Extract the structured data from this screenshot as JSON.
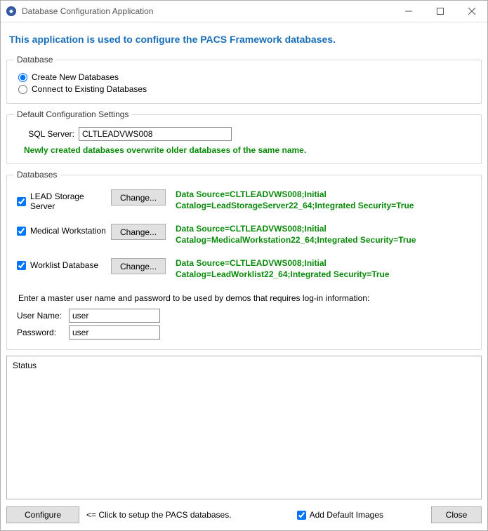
{
  "window": {
    "title": "Database Configuration Application"
  },
  "headline": "This application is used to configure the PACS Framework databases.",
  "database_group": {
    "legend": "Database",
    "create_label": "Create New Databases",
    "connect_label": "Connect to Existing Databases"
  },
  "config_group": {
    "legend": "Default Configuration Settings",
    "sql_label": "SQL Server:",
    "sql_value": "CLTLEADVWS008",
    "overwrite_note": "Newly created databases overwrite older databases of the same name."
  },
  "databases_group": {
    "legend": "Databases",
    "change_label": "Change...",
    "items": [
      {
        "label": "LEAD Storage Server",
        "conn": "Data Source=CLTLEADVWS008;Initial Catalog=LeadStorageServer22_64;Integrated Security=True"
      },
      {
        "label": "Medical Workstation",
        "conn": "Data Source=CLTLEADVWS008;Initial Catalog=MedicalWorkstation22_64;Integrated Security=True"
      },
      {
        "label": "Worklist Database",
        "conn": "Data Source=CLTLEADVWS008;Initial Catalog=LeadWorklist22_64;Integrated Security=True"
      }
    ],
    "master_note": "Enter a master user name and password to be used by demos that requires log-in information:",
    "username_label": "User Name:",
    "username_value": "user",
    "password_label": "Password:",
    "password_value": "user"
  },
  "status_label": "Status",
  "footer": {
    "configure_label": "Configure",
    "hint": "<= Click to setup the PACS databases.",
    "add_images_label": "Add Default Images",
    "close_label": "Close"
  }
}
